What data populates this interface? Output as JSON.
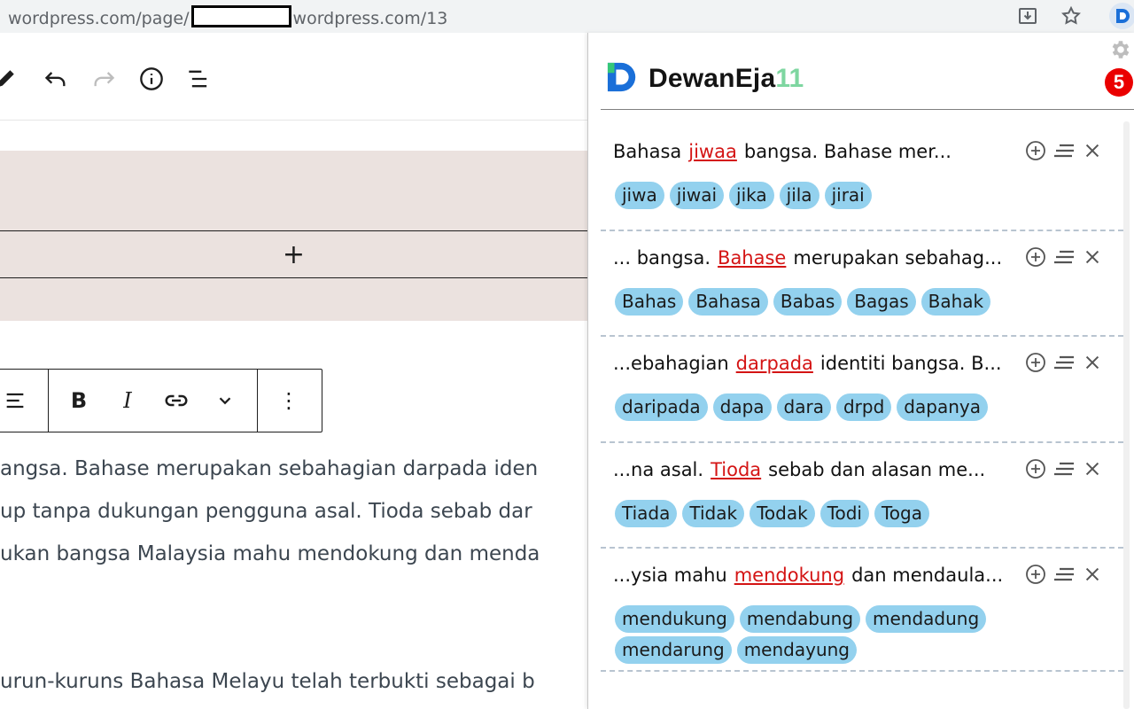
{
  "browser": {
    "url_prefix": "wordpress.com/page/",
    "url_suffix": "wordpress.com/13"
  },
  "editor": {
    "paragraph_lines": [
      "angsa.  Bahase merupakan sebahagian darpada iden",
      "up tanpa dukungan pengguna asal.  Tioda sebab dar",
      "ukan bangsa Malaysia mahu mendokung dan menda",
      "urun-kuruns Bahasa Melayu telah terbukti sebagai b"
    ],
    "toolbar": {
      "bold": "B",
      "italic": "I",
      "more": "⋮"
    },
    "inserter": "+"
  },
  "extension": {
    "brand_main": "DewanEja",
    "brand_version": "11",
    "error_count": "5",
    "colors": {
      "error": "#d41414",
      "chip": "#93d1ee",
      "badge": "#ea0000"
    },
    "cards": [
      {
        "before": "Bahasa",
        "error": "jiwaa",
        "after": "bangsa. Bahase mer...",
        "suggestions": [
          "jiwa",
          "jiwai",
          "jika",
          "jila",
          "jirai"
        ]
      },
      {
        "before": "... bangsa.",
        "error": "Bahase",
        "after": "merupakan sebahag...",
        "suggestions": [
          "Bahas",
          "Bahasa",
          "Babas",
          "Bagas",
          "Bahak"
        ]
      },
      {
        "before": "...ebahagian",
        "error": "darpada",
        "after": "identiti bangsa. B...",
        "suggestions": [
          "daripada",
          "dapa",
          "dara",
          "drpd",
          "dapanya"
        ]
      },
      {
        "before": "...na asal.",
        "error": "Tioda",
        "after": "sebab dan alasan me...",
        "suggestions": [
          "Tiada",
          "Tidak",
          "Todak",
          "Todi",
          "Toga"
        ]
      },
      {
        "before": "...ysia mahu",
        "error": "mendokung",
        "after": "dan mendaula...",
        "suggestions": [
          "mendukung",
          "mendabung",
          "mendadung",
          "mendarung",
          "mendayung"
        ]
      }
    ]
  }
}
